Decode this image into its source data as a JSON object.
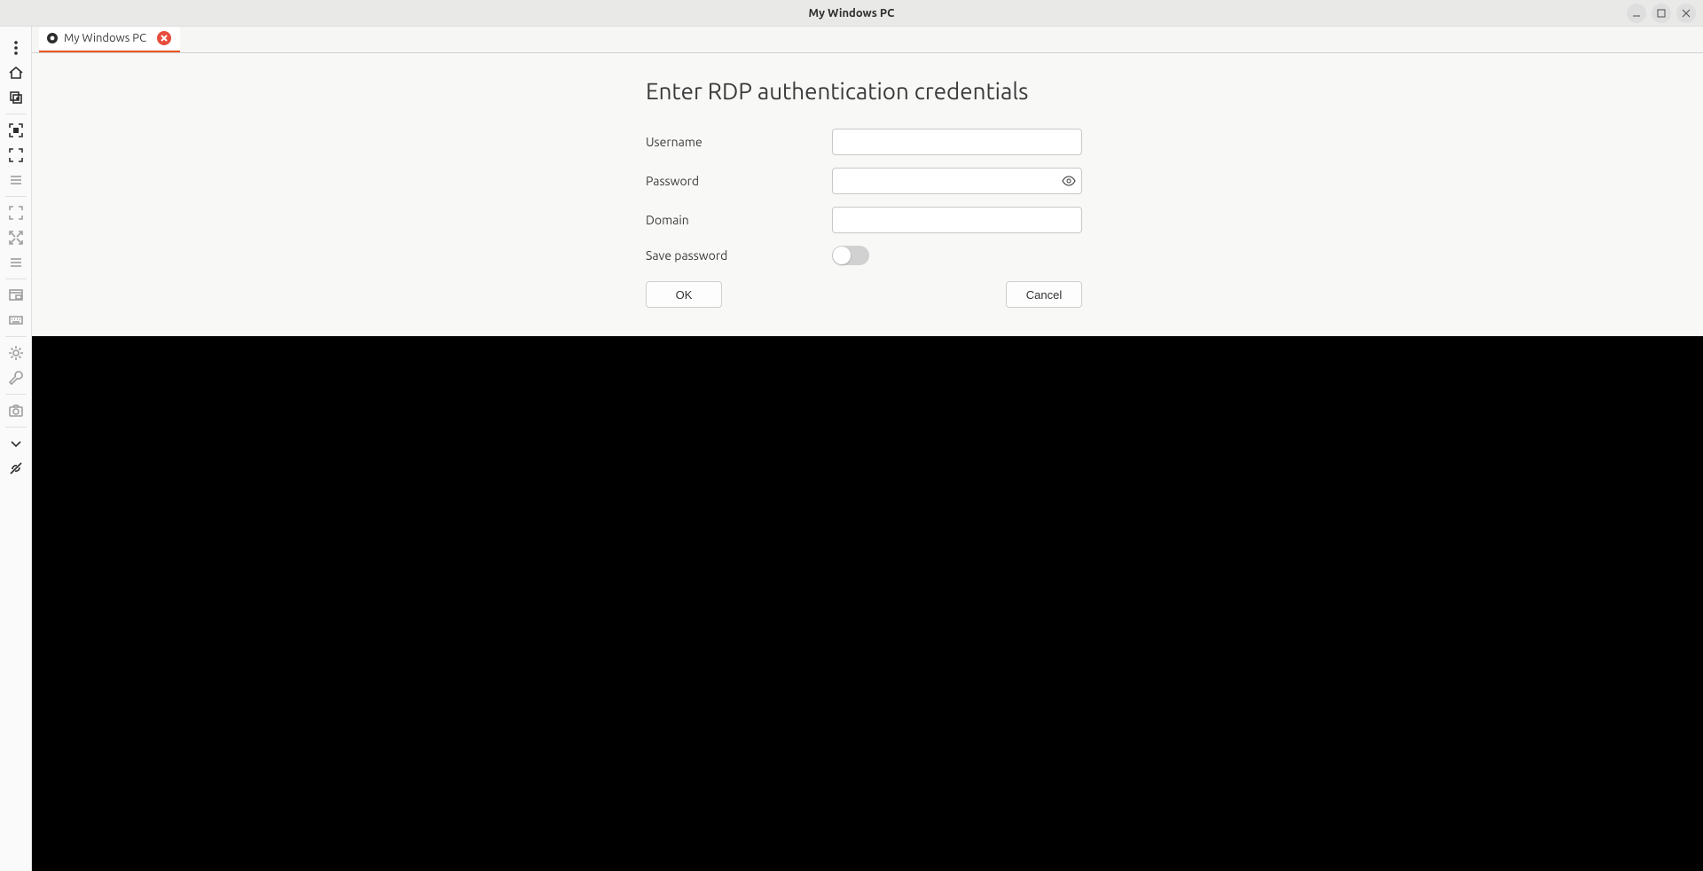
{
  "window": {
    "title": "My Windows PC"
  },
  "tab": {
    "label": "My Windows PC"
  },
  "dialog": {
    "title": "Enter RDP authentication credentials",
    "username_label": "Username",
    "username_value": "",
    "password_label": "Password",
    "password_value": "",
    "domain_label": "Domain",
    "domain_value": "",
    "save_pw_label": "Save password",
    "ok_label": "OK",
    "cancel_label": "Cancel",
    "save_pw_on": false
  }
}
